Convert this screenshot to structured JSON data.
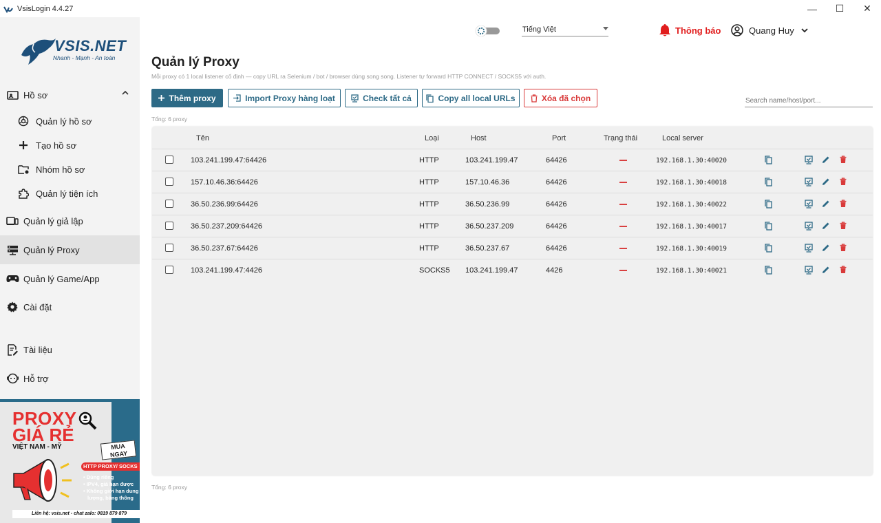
{
  "window": {
    "title": "VsisLogin 4.4.27",
    "minimize": "—",
    "maximize": "☐",
    "close": "✕"
  },
  "sidebar": {
    "logo_text": "VSIS.NET",
    "logo_tagline": "Nhanh - Mạnh - An toàn",
    "items": [
      {
        "label": "Hồ sơ",
        "icon": "profile-folder-icon"
      },
      {
        "label": "Quản lý hồ sơ",
        "icon": "browser-icon"
      },
      {
        "label": "Tạo hồ sơ",
        "icon": "plus-icon"
      },
      {
        "label": "Nhóm hồ sơ",
        "icon": "folder-settings-icon"
      },
      {
        "label": "Quản lý tiện ích",
        "icon": "puzzle-icon"
      },
      {
        "label": "Quản lý giả lập",
        "icon": "emulator-icon"
      },
      {
        "label": "Quản lý Proxy",
        "icon": "server-icon"
      },
      {
        "label": "Quản lý Game/App",
        "icon": "gamepad-icon"
      },
      {
        "label": "Cài đặt",
        "icon": "gear-icon"
      },
      {
        "label": "Tài liệu",
        "icon": "document-icon"
      },
      {
        "label": "Hỗ trợ",
        "icon": "support-icon"
      }
    ],
    "active_index": 6
  },
  "promo": {
    "title_line1": "PROXY",
    "title_line2": "GIÁ RẺ",
    "subtitle": "VIỆT NAM - MỸ",
    "buy_line1": "MUA",
    "buy_line2": "NGAY",
    "badge": "HTTP PROXY/ SOCKS",
    "features": [
      "• Dùng riêng",
      "• IPV4, giá hạn được",
      "• Không giới hạn dung",
      "lượng, băng thông"
    ],
    "footer": "Liên hệ: vsis.net - chat zalo: 0819 879 879"
  },
  "header": {
    "language": "Tiếng Việt",
    "notification_label": "Thông báo",
    "user_name": "Quang Huy"
  },
  "page": {
    "title": "Quản lý Proxy",
    "description": "Mỗi proxy có 1 local listener cố định — copy URL ra Selenium / bot / browser dùng song song. Listener tự forward HTTP CONNECT / SOCKS5 với auth.",
    "total_top": "Tổng: 6 proxy",
    "total_bottom": "Tổng: 6 proxy",
    "search_placeholder": "Search name/host/port..."
  },
  "toolbar": {
    "add": "Thêm proxy",
    "import": "Import Proxy hàng loạt",
    "check_all": "Check tất cả",
    "copy_all": "Copy all local URLs",
    "delete_selected": "Xóa đã chọn"
  },
  "table": {
    "columns": [
      "Tên",
      "Loại",
      "Host",
      "Port",
      "Trạng thái",
      "Local server"
    ],
    "rows": [
      {
        "name": "103.241.199.47:64426",
        "type": "HTTP",
        "host": "103.241.199.47",
        "port": "64426",
        "local": "192.168.1.30:40020"
      },
      {
        "name": "157.10.46.36:64426",
        "type": "HTTP",
        "host": "157.10.46.36",
        "port": "64426",
        "local": "192.168.1.30:40018"
      },
      {
        "name": "36.50.236.99:64426",
        "type": "HTTP",
        "host": "36.50.236.99",
        "port": "64426",
        "local": "192.168.1.30:40022"
      },
      {
        "name": "36.50.237.209:64426",
        "type": "HTTP",
        "host": "36.50.237.209",
        "port": "64426",
        "local": "192.168.1.30:40017"
      },
      {
        "name": "36.50.237.67:64426",
        "type": "HTTP",
        "host": "36.50.237.67",
        "port": "64426",
        "local": "192.168.1.30:40019"
      },
      {
        "name": "103.241.199.47:4426",
        "type": "SOCKS5",
        "host": "103.241.199.47",
        "port": "4426",
        "local": "192.168.1.30:40021"
      }
    ]
  },
  "colors": {
    "accent": "#2d6a86",
    "danger": "#d93a3a",
    "notify": "#e11d1d",
    "sidebar_bg": "#f3f3f3"
  }
}
